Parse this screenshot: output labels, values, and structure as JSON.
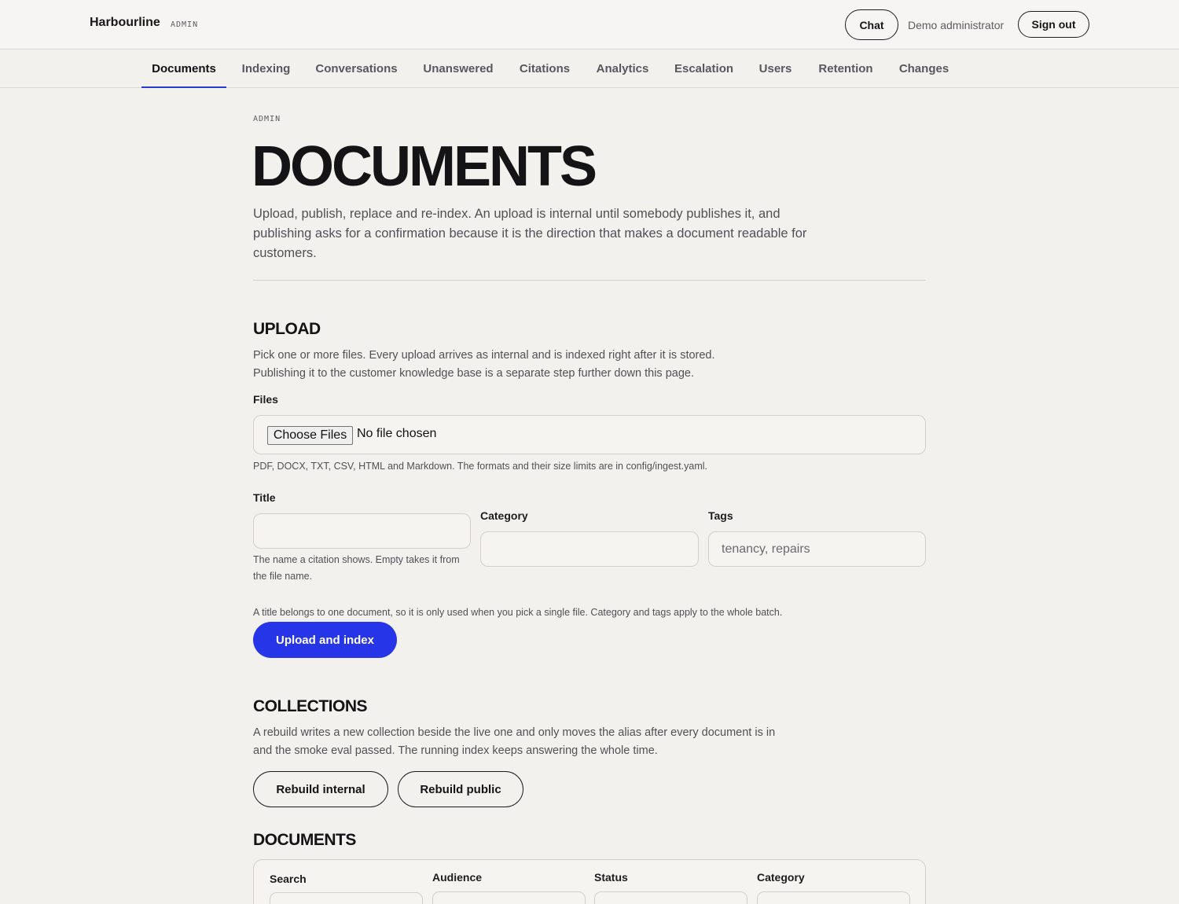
{
  "header": {
    "brand": "Harbourline",
    "brand_tag": "ADMIN",
    "chat_label": "Chat",
    "user_name": "Demo administrator",
    "signout_label": "Sign out"
  },
  "nav": {
    "items": [
      {
        "label": "Documents",
        "active": true
      },
      {
        "label": "Indexing"
      },
      {
        "label": "Conversations"
      },
      {
        "label": "Unanswered"
      },
      {
        "label": "Citations"
      },
      {
        "label": "Analytics"
      },
      {
        "label": "Escalation"
      },
      {
        "label": "Users"
      },
      {
        "label": "Retention"
      },
      {
        "label": "Changes"
      }
    ]
  },
  "page": {
    "eyebrow": "ADMIN",
    "title": "DOCUMENTS",
    "lead": "Upload, publish, replace and re-index. An upload is internal until somebody publishes it, and publishing asks for a confirmation because it is the direction that makes a document readable for customers."
  },
  "upload": {
    "title": "UPLOAD",
    "text": "Pick one or more files. Every upload arrives as internal and is indexed right after it is stored. Publishing it to the customer knowledge base is a separate step further down this page.",
    "files_label": "Files",
    "choose_files": "Choose Files",
    "no_file": "No file chosen",
    "formats_help": "PDF, DOCX, TXT, CSV, HTML and Markdown. The formats and their size limits are in config/ingest.yaml.",
    "title_label": "Title",
    "title_value": "",
    "title_help": "The name a citation shows. Empty takes it from the file name.",
    "category_label": "Category",
    "category_value": "",
    "tags_label": "Tags",
    "tags_placeholder": "tenancy, repairs",
    "batch_help": "A title belongs to one document, so it is only used when you pick a single file. Category and tags apply to the whole batch.",
    "submit_label": "Upload and index"
  },
  "collections": {
    "title": "COLLECTIONS",
    "text": "A rebuild writes a new collection beside the live one and only moves the alias after every document is in and the smoke eval passed. The running index keeps answering the whole time.",
    "rebuild_internal": "Rebuild internal",
    "rebuild_public": "Rebuild public"
  },
  "documents": {
    "title": "DOCUMENTS",
    "filters": {
      "search_label": "Search",
      "audience_label": "Audience",
      "status_label": "Status",
      "category_label": "Category"
    }
  }
}
